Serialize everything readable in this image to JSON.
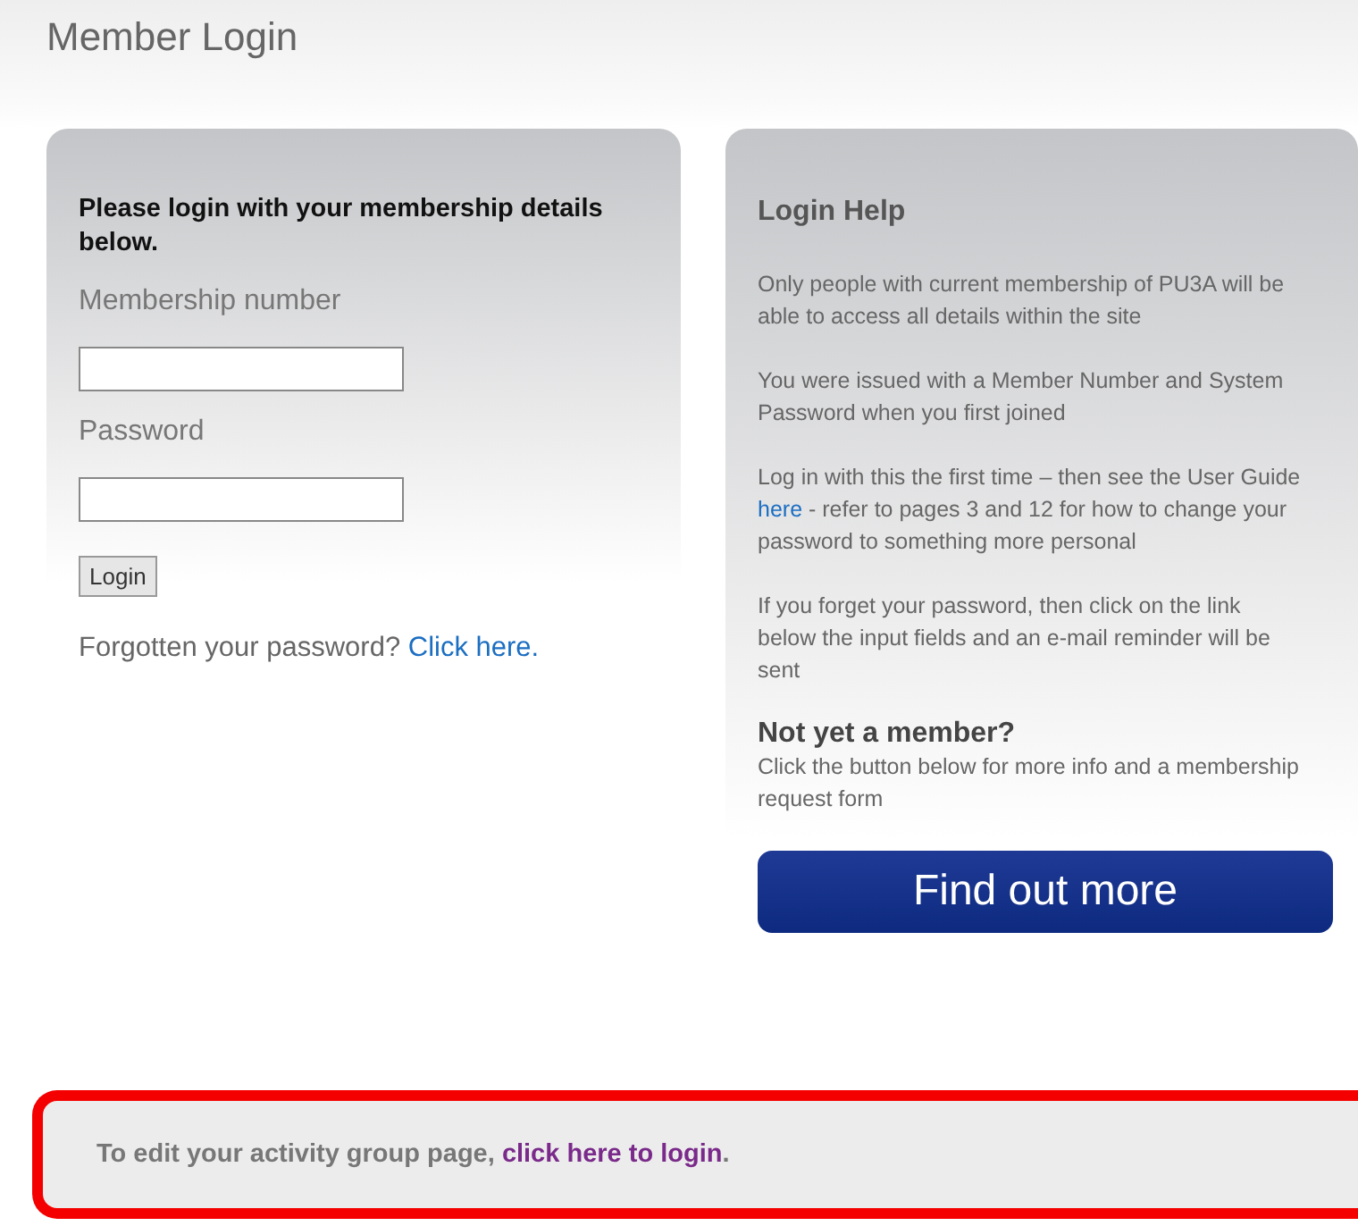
{
  "page_title": "Member Login",
  "login_panel": {
    "intro": "Please login with your membership details below.",
    "fields": [
      {
        "label": "Membership number"
      },
      {
        "label": "Password"
      }
    ],
    "login_button": "Login",
    "forgot": {
      "text": "Forgotten your password? ",
      "link": "Click here."
    }
  },
  "help_panel": {
    "title": "Login Help",
    "paragraphs": [
      {
        "before": "Only people with current membership of PU3A will be able to access all details within the site"
      },
      {
        "before": "You were issued with a Member Number and System Password when you first joined"
      },
      {
        "before": "Log in with this the first time – then see the User Guide ",
        "link": "here",
        "after": " - refer to pages 3 and 12 for how to change your password to something more personal"
      },
      {
        "before": "If you forget your password, then click on the link below the input fields and an e-mail reminder will be sent"
      }
    ],
    "join_heading": "Not yet a member?",
    "join_text": "Click the button below for more info and a membership request form",
    "find_out_button": "Find out more"
  },
  "edit_notice": {
    "text": "To edit your activity group page, ",
    "link": "click here to login",
    "after": "."
  }
}
